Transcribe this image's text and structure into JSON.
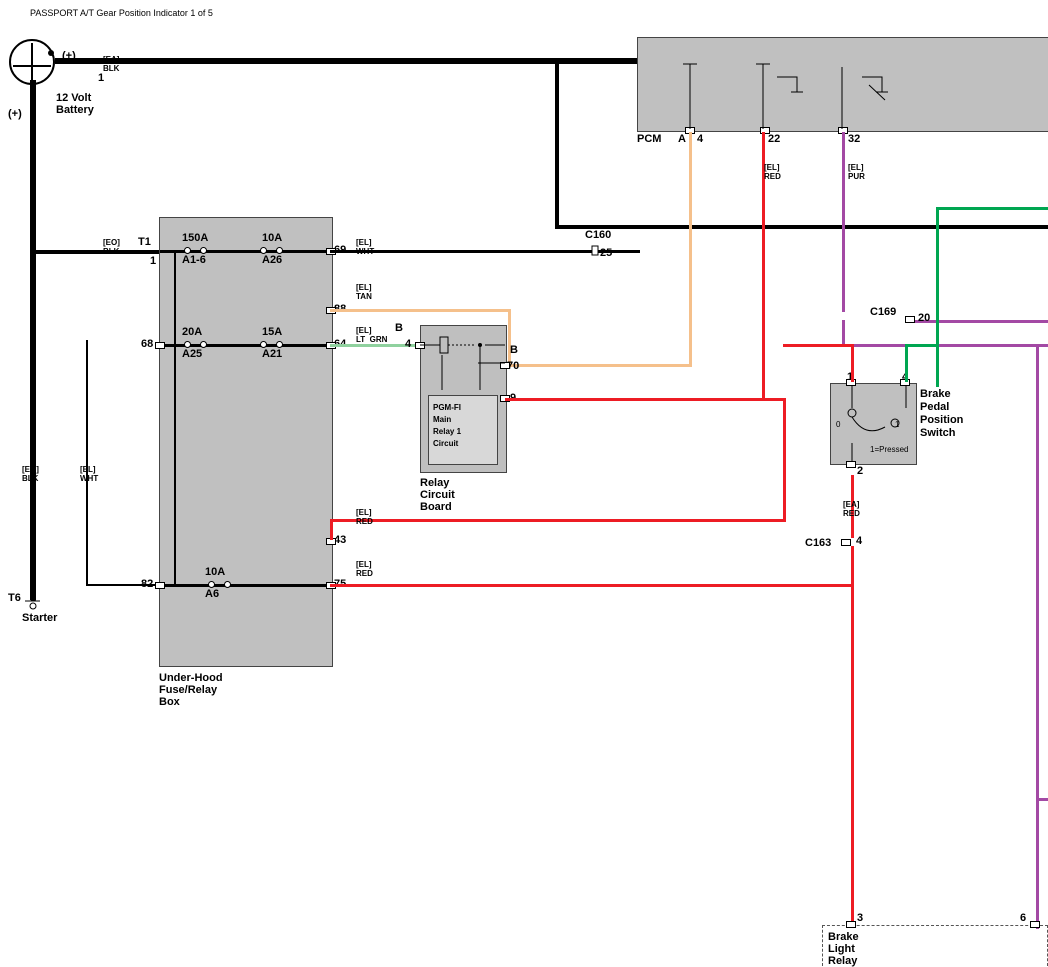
{
  "title": "PASSPORT A/T Gear Position Indicator 1 of 5",
  "battery_label": "12 Volt\nBattery",
  "starter_label": "Starter",
  "plus": "(+)",
  "underhood": "Under-Hood\nFuse/Relay\nBox",
  "relay_board": "Relay\nCircuit\nBoard",
  "relay_inner": "PGM-FI\nMain\nRelay 1\nCircuit",
  "pcm": "PCM",
  "brake_switch": "Brake\nPedal\nPosition\nSwitch",
  "pressed": "1=Pressed",
  "brake_relay": "Brake\nLight\nRelay",
  "conn": {
    "C160": "C160",
    "C169": "C169",
    "C163": "C163"
  },
  "pins": {
    "p1": "1",
    "p4": "4",
    "p22": "22",
    "p25": "25",
    "p32": "32",
    "p68": "68",
    "p69": "69",
    "p88": "88",
    "p64": "64",
    "p43": "43",
    "p75": "75",
    "p82": "82",
    "p9": "9",
    "p20": "20",
    "p70": "70",
    "p2": "2",
    "p3": "3",
    "p6": "6",
    "T1": "T1",
    "T6": "T6",
    "T61": "1",
    "A": "A",
    "B": "B"
  },
  "wire": {
    "ea_blk": "[EA]\nBLK",
    "eo_blk": "[EO]\nBLK",
    "el_wht": "[EL]\nWHT",
    "el_tan": "[EL]\nTAN",
    "el_ltgrn": "[EL]\nLT  GRN",
    "el_red": "[EL]\nRED",
    "ea_red": "[EA]\nRED",
    "el_pur": "[EL]\nPUR"
  },
  "fuses": {
    "f150": "150A",
    "fa16": "A1-6",
    "f10": "10A",
    "fa26": "A26",
    "f20": "20A",
    "fa25": "A25",
    "f15": "15A",
    "fa21": "A21",
    "f10b": "10A",
    "fa6": "A6"
  },
  "zero": "0",
  "one": "1"
}
